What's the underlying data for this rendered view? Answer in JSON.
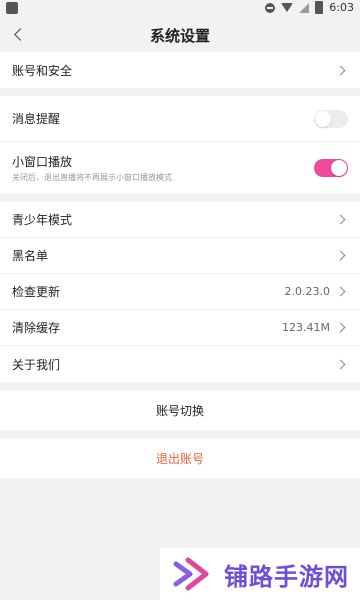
{
  "status_bar": {
    "time": "6:03"
  },
  "header": {
    "title": "系统设置"
  },
  "account_security": {
    "label": "账号和安全"
  },
  "notifications": {
    "label": "消息提醒",
    "enabled": false
  },
  "mini_window": {
    "label": "小窗口播放",
    "subtitle": "关闭后，退出直播将不再展示小窗口播放模式",
    "enabled": true
  },
  "list": {
    "teen_mode": {
      "label": "青少年模式"
    },
    "blacklist": {
      "label": "黑名单"
    },
    "check_update": {
      "label": "检查更新",
      "value": "2.0.23.0"
    },
    "clear_cache": {
      "label": "清除缓存",
      "value": "123.41M"
    },
    "about": {
      "label": "关于我们"
    }
  },
  "actions": {
    "switch_account": "账号切换",
    "logout": "退出账号"
  },
  "watermark": {
    "text": "铺路手游网"
  },
  "colors": {
    "accent_pink": "#ec4a9a",
    "logout_orange": "#e8603a",
    "watermark_purple": "#6b4fd8"
  }
}
